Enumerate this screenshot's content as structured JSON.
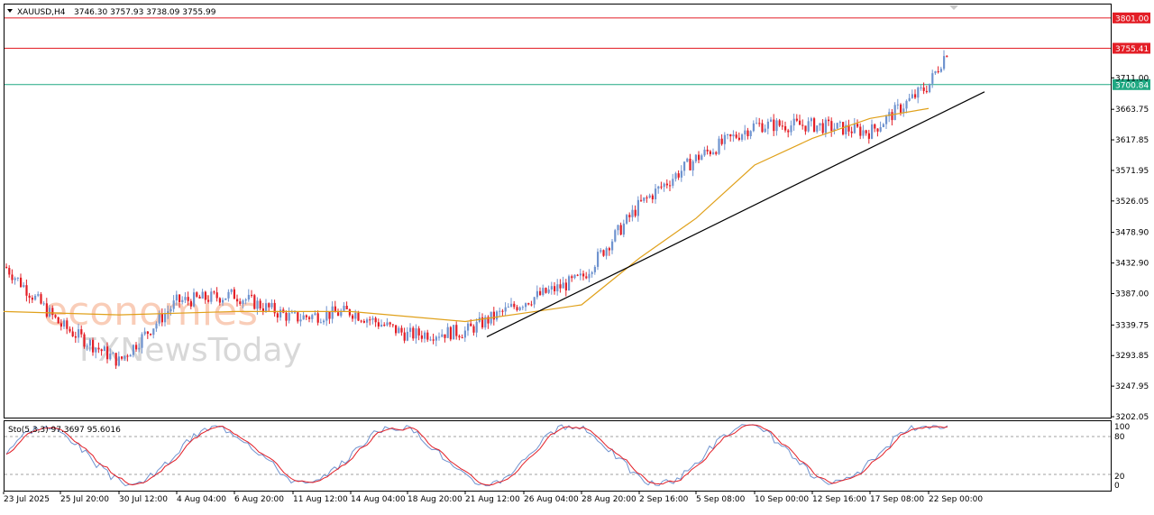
{
  "header": {
    "symbol": "XAUUSD,H4",
    "ohlc": "3746.30 3757.93 3738.09 3755.99"
  },
  "oscillator": {
    "label": "Sto(5,3,3) 97.3697 95.6016",
    "levels": [
      "100",
      "80",
      "20",
      "0"
    ]
  },
  "watermark": {
    "line1": "economies",
    "line2": "FXNewsToday"
  },
  "colors": {
    "bull": "#6f93cf",
    "bear": "#e31e26",
    "ma": "#e0a11b",
    "resistance": "#e31e26",
    "support": "#1fa882",
    "trendline": "#000000",
    "sto_main": "#6f93cf",
    "sto_signal": "#e31e26"
  },
  "chart_data": {
    "type": "line",
    "symbol": "XAUUSD",
    "timeframe": "H4",
    "y_ticks": [
      "3711.00",
      "3663.75",
      "3617.85",
      "3571.95",
      "3526.05",
      "3478.90",
      "3432.90",
      "3387.00",
      "3339.75",
      "3293.85",
      "3247.95",
      "3202.05"
    ],
    "ylim": [
      3202.05,
      3813
    ],
    "x_ticks": [
      "23 Jul 2025",
      "25 Jul 20:00",
      "30 Jul 12:00",
      "4 Aug 04:00",
      "6 Aug 20:00",
      "11 Aug 12:00",
      "14 Aug 04:00",
      "18 Aug 20:00",
      "21 Aug 12:00",
      "26 Aug 04:00",
      "28 Aug 20:00",
      "2 Sep 16:00",
      "5 Sep 08:00",
      "10 Sep 00:00",
      "12 Sep 16:00",
      "17 Sep 08:00",
      "22 Sep 00:00"
    ],
    "horizontal_lines": [
      {
        "value": 3801.0,
        "label": "3801.00"
      },
      {
        "value": 3755.41,
        "label": "3755.41"
      },
      {
        "value": 3700.84,
        "label": "3700.84"
      }
    ],
    "price_path": [
      [
        "23 Jul 2025",
        3430
      ],
      [
        "25 Jul 20:00",
        3340
      ],
      [
        "30 Jul 12:00",
        3285
      ],
      [
        "4 Aug 04:00",
        3375
      ],
      [
        "6 Aug 20:00",
        3385
      ],
      [
        "11 Aug 12:00",
        3350
      ],
      [
        "14 Aug 04:00",
        3360
      ],
      [
        "18 Aug 20:00",
        3325
      ],
      [
        "21 Aug 12:00",
        3330
      ],
      [
        "26 Aug 04:00",
        3375
      ],
      [
        "28 Aug 20:00",
        3410
      ],
      [
        "2 Sep 16:00",
        3520
      ],
      [
        "5 Sep 08:00",
        3590
      ],
      [
        "10 Sep 00:00",
        3640
      ],
      [
        "12 Sep 16:00",
        3640
      ],
      [
        "17 Sep 08:00",
        3630
      ],
      [
        "22 Sep 00:00",
        3700
      ],
      [
        "22 Sep 00:00",
        3755.99
      ]
    ],
    "moving_average_path": [
      [
        "23 Jul 2025",
        3360
      ],
      [
        "30 Jul 12:00",
        3355
      ],
      [
        "6 Aug 20:00",
        3360
      ],
      [
        "14 Aug 04:00",
        3360
      ],
      [
        "21 Aug 12:00",
        3345
      ],
      [
        "28 Aug 20:00",
        3370
      ],
      [
        "2 Sep 16:00",
        3440
      ],
      [
        "5 Sep 08:00",
        3500
      ],
      [
        "10 Sep 00:00",
        3580
      ],
      [
        "12 Sep 16:00",
        3620
      ],
      [
        "17 Sep 08:00",
        3650
      ],
      [
        "22 Sep 00:00",
        3665
      ]
    ],
    "trendline": [
      [
        "21 Aug 12:00",
        3322
      ],
      [
        "22 Sep 00:00",
        3690
      ]
    ],
    "stochastic": {
      "main": 97.3697,
      "signal": 95.6016,
      "levels": [
        80,
        20
      ]
    }
  }
}
